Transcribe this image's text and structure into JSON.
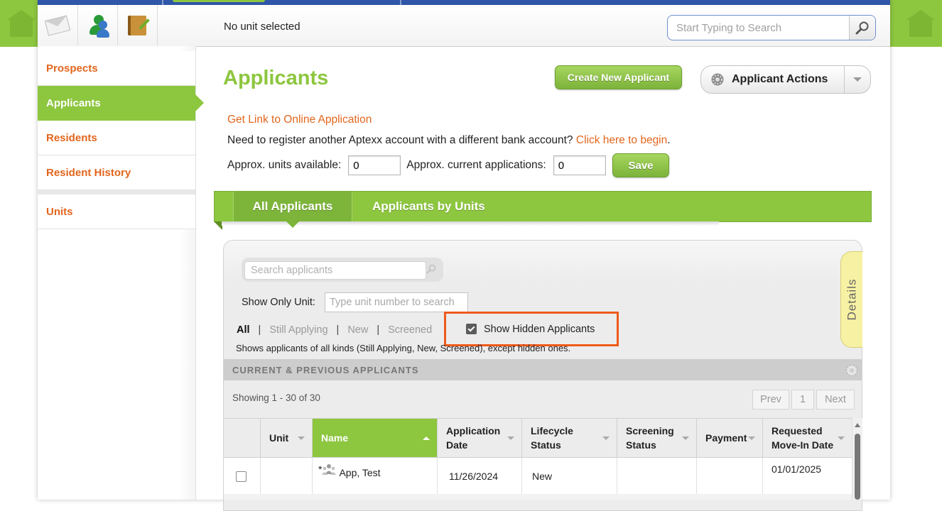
{
  "header": {
    "unit_status": "No unit selected",
    "search_placeholder": "Start Typing to Search"
  },
  "sidebar": {
    "items": [
      {
        "label": "Prospects"
      },
      {
        "label": "Applicants"
      },
      {
        "label": "Residents"
      },
      {
        "label": "Resident History"
      },
      {
        "label": "Units"
      }
    ]
  },
  "main": {
    "title": "Applicants",
    "create_button": "Create New Applicant",
    "actions_button": "Applicant Actions",
    "online_link": "Get Link to Online Application",
    "register_text": "Need to register another Aptexx account with a different bank account?",
    "register_link": "Click here to begin",
    "register_end": ".",
    "units_label": "Approx. units available:",
    "units_value": "0",
    "apps_label": "Approx. current applications:",
    "apps_value": "0",
    "save_button": "Save"
  },
  "tabs": [
    {
      "label": "All Applicants"
    },
    {
      "label": "Applicants by Units"
    }
  ],
  "panel": {
    "search_placeholder": "Search applicants",
    "show_unit_label": "Show Only Unit:",
    "show_unit_placeholder": "Type unit number to search",
    "filters": [
      "All",
      "Still Applying",
      "New",
      "Screened"
    ],
    "hidden_label": "Show Hidden Applicants",
    "description": "Shows applicants of all kinds (Still Applying, New, Screened), except hidden ones.",
    "details_tab": "Details",
    "section_title": "CURRENT & PREVIOUS APPLICANTS",
    "showing": "Showing 1 - 30 of 30",
    "pager": {
      "prev": "Prev",
      "page": "1",
      "next": "Next"
    }
  },
  "table": {
    "columns": [
      {
        "label": "Unit"
      },
      {
        "label": "Name"
      },
      {
        "label": "Application Date"
      },
      {
        "label": "Lifecycle Status"
      },
      {
        "label": "Screening Status"
      },
      {
        "label": "Payment"
      },
      {
        "label": "Requested Move-In Date"
      }
    ],
    "rows": [
      {
        "unit": "",
        "marker": "*",
        "name": "App, Test",
        "app_date": "11/26/2024",
        "lifecycle": "New",
        "screening": "",
        "payment": "",
        "move_in": "01/01/2025"
      }
    ]
  },
  "colors": {
    "brand_green": "#8dc63f",
    "link_orange": "#e2661e",
    "top_blue": "#2f56a8",
    "highlight": "#ee5a1a"
  }
}
